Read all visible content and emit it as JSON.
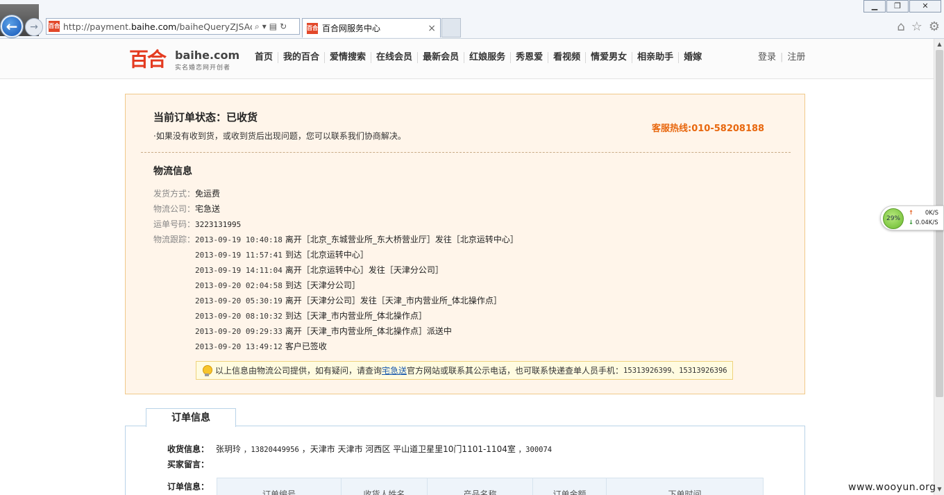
{
  "browser": {
    "address_prefix": "http://payment.",
    "address_domain": "baihe.com",
    "address_path": "/baiheQueryZJSActio",
    "tab_title": "百合网服务中心",
    "favicon_text": "百合"
  },
  "header": {
    "logo_mark": "百合",
    "logo_domain": "baihe.com",
    "logo_slogan": "实名婚恋网开创者",
    "nav": [
      "首页",
      "我的百合",
      "爱情搜索",
      "在线会员",
      "最新会员",
      "红娘服务",
      "秀恩爱",
      "看视频",
      "情爱男女",
      "相亲助手",
      "婚嫁"
    ],
    "login": "登录",
    "register": "注册"
  },
  "status": {
    "title": "当前订单状态：已收货",
    "note": "·如果没有收到货，或收到货后出现问题，您可以联系我们协商解决。",
    "hotline": "客服热线:010-58208188"
  },
  "logistics": {
    "title": "物流信息",
    "shipping_method_label": "发货方式：",
    "shipping_method": "免运费",
    "company_label": "物流公司：",
    "company": "宅急送",
    "tracking_no_label": "运单号码：",
    "tracking_no": "3223131995",
    "tracking_label": "物流跟踪：",
    "tracking": [
      {
        "time": "2013-09-19 10:40:18",
        "event": "离开［北京_东城营业所_东大桥营业厅］发往［北京运转中心］"
      },
      {
        "time": "2013-09-19 11:57:41",
        "event": "到达［北京运转中心］"
      },
      {
        "time": "2013-09-19 14:11:04",
        "event": "离开［北京运转中心］发往［天津分公司］"
      },
      {
        "time": "2013-09-20 02:04:58",
        "event": "到达［天津分公司］"
      },
      {
        "time": "2013-09-20 05:30:19",
        "event": "离开［天津分公司］发往［天津_市内营业所_体北操作点］"
      },
      {
        "time": "2013-09-20 08:10:32",
        "event": "到达［天津_市内营业所_体北操作点］"
      },
      {
        "time": "2013-09-20 09:29:33",
        "event": "离开［天津_市内营业所_体北操作点］派送中"
      },
      {
        "time": "2013-09-20 13:49:12",
        "event": "客户已签收"
      }
    ],
    "tip_before": "以上信息由物流公司提供，如有疑问，请查询",
    "tip_link": "宅急送",
    "tip_after": "官方网站或联系其公示电话，也可联系快递查单人员手机：",
    "tip_phones": "15313926399、15313926396"
  },
  "order": {
    "tab": "订单信息",
    "consignee_label": "收货信息：",
    "consignee_name": "张玥玲",
    "consignee_phone": "，13820449956",
    "consignee_address": "，天津市 天津市 河西区 平山道卫星里10门1101-1104室",
    "consignee_zip": "，300074",
    "buyer_msg_label": "买家留言：",
    "order_info_label": "订单信息：",
    "columns": [
      "订单编号",
      "收货人姓名",
      "产品名称",
      "订单金额",
      "下单时间"
    ]
  },
  "speed_widget": {
    "percent": "29%",
    "upload": "0K/S",
    "download": "0.04K/S"
  },
  "watermark": "www.wooyun.org"
}
